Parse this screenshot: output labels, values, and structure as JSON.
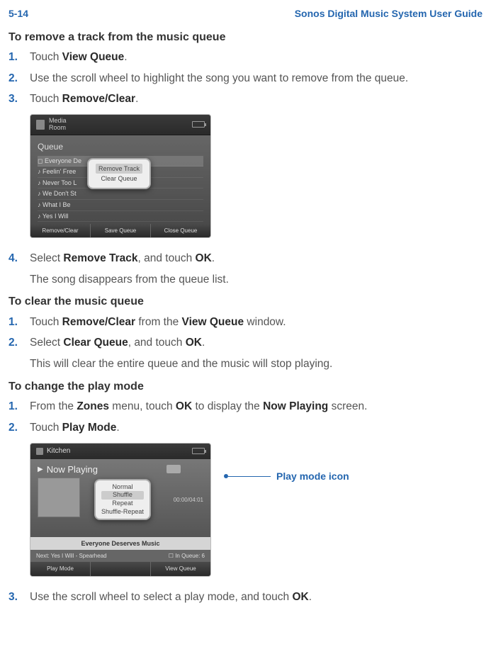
{
  "header": {
    "pageNumber": "5-14",
    "guideTitle": "Sonos Digital Music System User Guide"
  },
  "section1": {
    "title": "To remove a track from the music queue",
    "steps": [
      {
        "n": "1.",
        "prefix": "Touch ",
        "bold1": "View Queue",
        "suffix": "."
      },
      {
        "n": "2.",
        "text": "Use the scroll wheel to highlight the song you want to remove from the queue."
      },
      {
        "n": "3.",
        "prefix": "Touch ",
        "bold1": "Remove/Clear",
        "suffix": "."
      }
    ],
    "step4": {
      "n": "4.",
      "prefix": "Select ",
      "bold1": "Remove Track",
      "mid": ", and touch ",
      "bold2": "OK",
      "suffix": "."
    },
    "note": "The song disappears from the queue list."
  },
  "screenshot1": {
    "room": "Media\nRoom",
    "queueLabel": "Queue",
    "tracks": [
      "◻ Everyone De",
      "♪ Feelin' Free",
      "♪ Never Too L",
      "♪ We Don't St",
      "♪ What I Be",
      "♪ Yes I Will"
    ],
    "popup": {
      "opt1": "Remove Track",
      "opt2": "Clear Queue"
    },
    "bottom": [
      "Remove/Clear",
      "Save Queue",
      "Close Queue"
    ]
  },
  "section2": {
    "title": "To clear the music queue",
    "step1": {
      "n": "1.",
      "prefix": "Touch ",
      "bold1": "Remove/Clear",
      "mid": " from the ",
      "bold2": "View Queue",
      "suffix": " window."
    },
    "step2": {
      "n": "2.",
      "prefix": "Select ",
      "bold1": "Clear Queue",
      "mid": ", and touch ",
      "bold2": "OK",
      "suffix": "."
    },
    "note": "This will clear the entire queue and the music will stop playing."
  },
  "section3": {
    "title": "To change the play mode",
    "step1": {
      "n": "1.",
      "prefix": "From the ",
      "bold1": "Zones",
      "mid": " menu, touch ",
      "bold2": "OK",
      "mid2": " to display the ",
      "bold3": "Now Playing",
      "suffix": " screen."
    },
    "step2": {
      "n": "2.",
      "prefix": "Touch ",
      "bold1": "Play Mode",
      "suffix": "."
    },
    "step3": {
      "n": "3.",
      "prefix": "Use the scroll wheel to select a play mode, and touch ",
      "bold1": "OK",
      "suffix": "."
    }
  },
  "screenshot2": {
    "room": "Kitchen",
    "title": "Now Playing",
    "popup": [
      "Normal",
      "Shuffle",
      "Repeat",
      "Shuffle-Repeat"
    ],
    "time": "00:00/04:01",
    "song": "Everyone Deserves Music",
    "next": "Next: Yes I Will - Spearhead",
    "inqueue": "☐ In Queue: 6",
    "bottom": [
      "Play Mode",
      "",
      "View Queue"
    ],
    "callout": "Play mode icon"
  }
}
